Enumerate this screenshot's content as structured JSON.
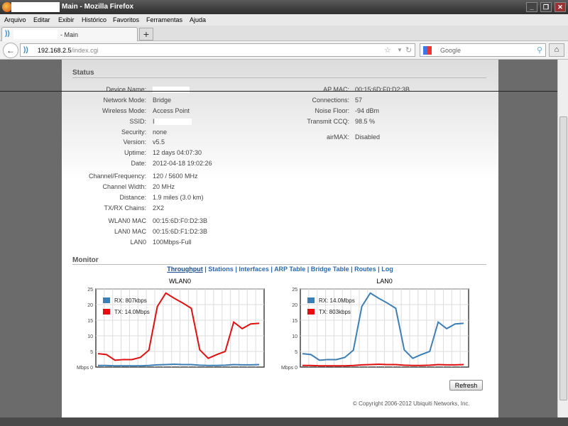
{
  "window": {
    "title": "Main - Mozilla Firefox",
    "minimize": "_",
    "restore": "❐",
    "close": "✕"
  },
  "menu": [
    "Arquivo",
    "Editar",
    "Exibir",
    "Histórico",
    "Favoritos",
    "Ferramentas",
    "Ajuda"
  ],
  "tab": {
    "label": "- Main",
    "new": "+"
  },
  "nav": {
    "url_host": "192.168.2.5",
    "url_path": "/index.cgi",
    "search_placeholder": "Google"
  },
  "status": {
    "title": "Status",
    "left": [
      {
        "label": "Device Name:",
        "value": ""
      },
      {
        "label": "Network Mode:",
        "value": "Bridge"
      },
      {
        "label": "Wireless Mode:",
        "value": "Access Point"
      },
      {
        "label": "SSID:",
        "value": "I"
      },
      {
        "label": "Security:",
        "value": "none"
      },
      {
        "label": "Version:",
        "value": "v5.5"
      },
      {
        "label": "Uptime:",
        "value": "12 days 04:07:30"
      },
      {
        "label": "Date:",
        "value": "2012-04-18 19:02:26"
      },
      {
        "label": "Channel/Frequency:",
        "value": "120 / 5600 MHz"
      },
      {
        "label": "Channel Width:",
        "value": "20 MHz"
      },
      {
        "label": "Distance:",
        "value": "1.9 miles (3.0 km)"
      },
      {
        "label": "TX/RX Chains:",
        "value": "2X2"
      },
      {
        "label": "WLAN0 MAC",
        "value": "00:15:6D:F0:D2:3B"
      },
      {
        "label": "LAN0 MAC",
        "value": "00:15:6D:F1:D2:3B"
      },
      {
        "label": "LAN0",
        "value": "100Mbps-Full"
      }
    ],
    "right": [
      {
        "label": "AP MAC:",
        "value": "00:15:6D:F0:D2:3B"
      },
      {
        "label": "Connections:",
        "value": "57"
      },
      {
        "label": "Noise Floor:",
        "value": "-94 dBm"
      },
      {
        "label": "Transmit CCQ:",
        "value": "98.5 %"
      },
      {
        "label": "airMAX:",
        "value": "Disabled"
      }
    ]
  },
  "monitor": {
    "title": "Monitor",
    "links": [
      "Throughput",
      "Stations",
      "Interfaces",
      "ARP Table",
      "Bridge Table",
      "Routes",
      "Log"
    ],
    "refresh": "Refresh"
  },
  "footer": "© Copyright 2006-2012 Ubiquiti Networks, Inc.",
  "colors": {
    "rx": "#3d7fb5",
    "tx": "#e01010"
  },
  "chart_data": [
    {
      "type": "line",
      "title": "WLAN0",
      "ylabel": "Mbps",
      "ylim": [
        0,
        25
      ],
      "yticks": [
        0,
        5,
        10,
        15,
        20,
        25
      ],
      "series": [
        {
          "name": "RX: 807kbps",
          "color": "#3d7fb5",
          "values": [
            0.5,
            0.5,
            0.4,
            0.4,
            0.4,
            0.4,
            0.5,
            0.7,
            0.8,
            0.9,
            0.8,
            0.8,
            0.6,
            0.5,
            0.5,
            0.6,
            0.8,
            0.7,
            0.7,
            0.8
          ]
        },
        {
          "name": "TX: 14.0Mbps",
          "color": "#e01010",
          "values": [
            4.3,
            4.0,
            2.2,
            2.4,
            2.4,
            3.1,
            5.4,
            19.4,
            23.7,
            22.0,
            20.5,
            18.8,
            5.5,
            2.8,
            4.0,
            5.0,
            14.4,
            12.3,
            13.8,
            14.0
          ]
        }
      ]
    },
    {
      "type": "line",
      "title": "LAN0",
      "ylabel": "Mbps",
      "ylim": [
        0,
        25
      ],
      "yticks": [
        0,
        5,
        10,
        15,
        20,
        25
      ],
      "series": [
        {
          "name": "RX: 14.0Mbps",
          "color": "#3d7fb5",
          "values": [
            4.3,
            4.0,
            2.2,
            2.4,
            2.4,
            3.1,
            5.4,
            19.4,
            23.7,
            22.0,
            20.5,
            18.8,
            5.5,
            2.8,
            4.0,
            5.0,
            14.4,
            12.3,
            13.8,
            14.0
          ]
        },
        {
          "name": "TX: 803kbps",
          "color": "#e01010",
          "values": [
            0.5,
            0.5,
            0.4,
            0.4,
            0.4,
            0.4,
            0.5,
            0.7,
            0.8,
            0.9,
            0.8,
            0.8,
            0.6,
            0.5,
            0.5,
            0.6,
            0.8,
            0.7,
            0.7,
            0.8
          ]
        }
      ]
    }
  ]
}
